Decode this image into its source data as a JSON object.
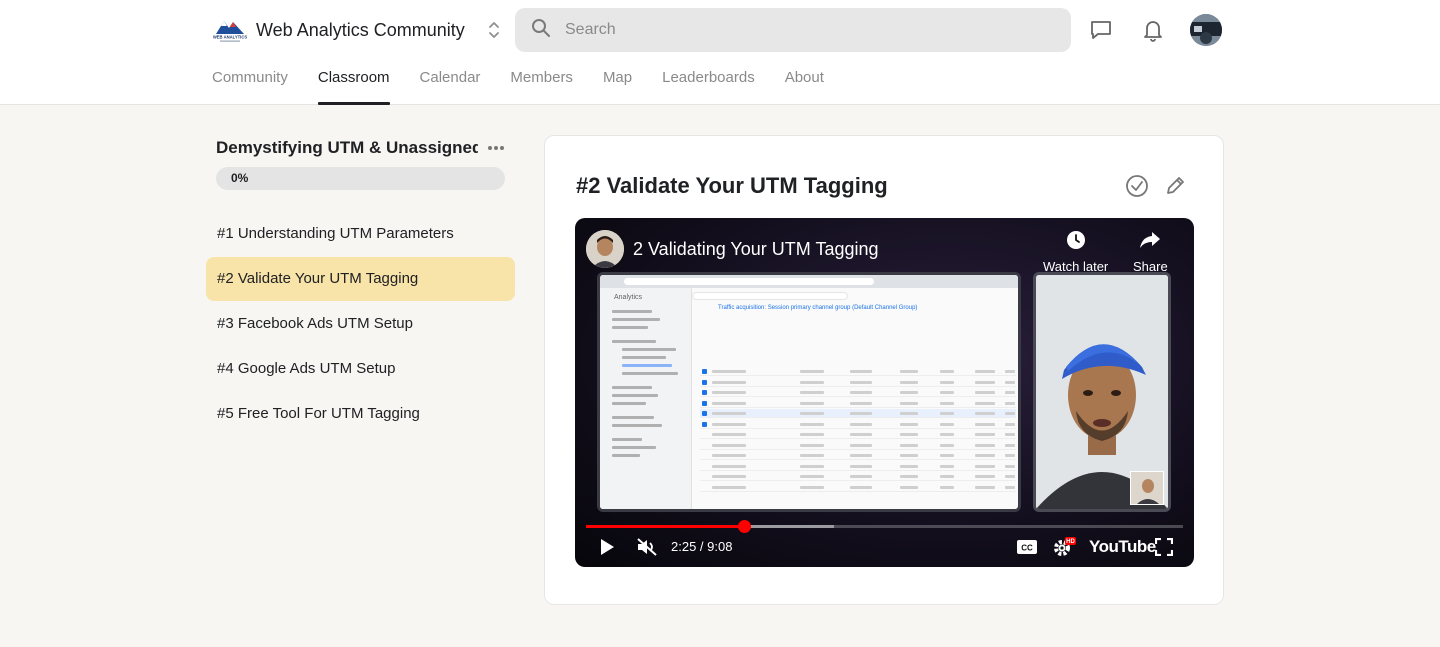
{
  "header": {
    "brand_name": "Web Analytics Community",
    "logo_text": "WEB ANALYTICS",
    "search_placeholder": "Search"
  },
  "nav": {
    "tabs": [
      {
        "label": "Community",
        "active": false
      },
      {
        "label": "Classroom",
        "active": true
      },
      {
        "label": "Calendar",
        "active": false
      },
      {
        "label": "Members",
        "active": false
      },
      {
        "label": "Map",
        "active": false
      },
      {
        "label": "Leaderboards",
        "active": false
      },
      {
        "label": "About",
        "active": false
      }
    ]
  },
  "course": {
    "title": "Demystifying UTM & Unassigned...",
    "progress_label": "0%",
    "progress_fraction": 0,
    "lessons": [
      {
        "label": "#1 Understanding UTM Parameters",
        "active": false
      },
      {
        "label": "#2 Validate Your UTM Tagging",
        "active": true
      },
      {
        "label": "#3 Facebook Ads UTM Setup",
        "active": false
      },
      {
        "label": "#4 Google Ads UTM Setup",
        "active": false
      },
      {
        "label": "#5 Free Tool For UTM Tagging",
        "active": false
      }
    ]
  },
  "lesson": {
    "title": "#2 Validate Your UTM Tagging"
  },
  "video": {
    "title": "2 Validating Your UTM Tagging",
    "watch_later_label": "Watch later",
    "share_label": "Share",
    "time_display": "2:25 / 9:08",
    "played_fraction": 0.265,
    "buffered_fraction": 0.415,
    "logo_text": "YouTube",
    "screen_analytics_label": "Analytics",
    "screen_heading": "Traffic acquisition: Session primary channel group (Default Channel Group)"
  },
  "colors": {
    "active_lesson_bg": "#f8e4a8",
    "progress_bg": "#e4e4e4",
    "scrubber": "#ff0000",
    "page_bg": "#f7f6f3"
  }
}
